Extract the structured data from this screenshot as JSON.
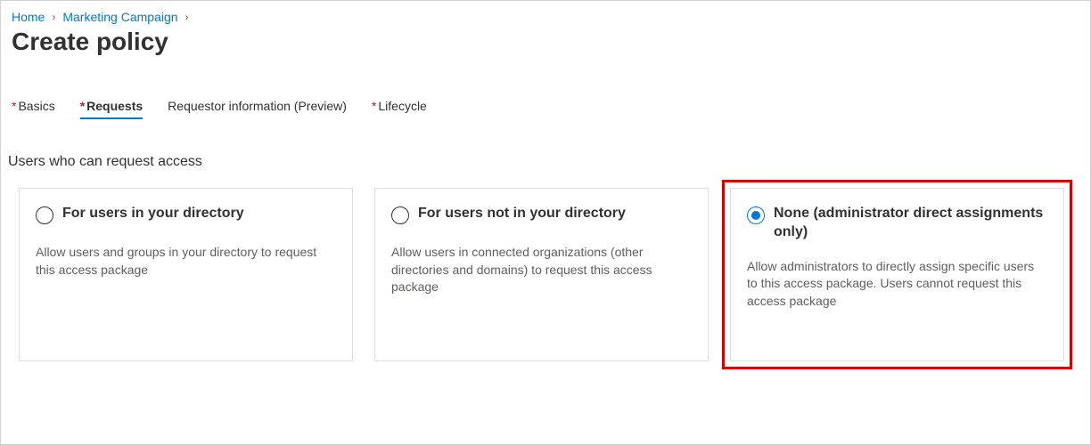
{
  "breadcrumb": {
    "home": "Home",
    "campaign": "Marketing Campaign"
  },
  "page": {
    "title": "Create policy"
  },
  "tabs": {
    "basics": "Basics",
    "requests": "Requests",
    "requestorInfo": "Requestor information (Preview)",
    "lifecycle": "Lifecycle"
  },
  "section": {
    "heading": "Users who can request access"
  },
  "options": {
    "inDirectory": {
      "title": "For users in your directory",
      "desc": "Allow users and groups in your directory to request this access package"
    },
    "notInDirectory": {
      "title": "For users not in your directory",
      "desc": "Allow users in connected organizations (other directories and domains) to request this access package"
    },
    "none": {
      "title": "None (administrator direct assignments only)",
      "desc": "Allow administrators to directly assign specific users to this access package. Users cannot request this access package"
    }
  }
}
